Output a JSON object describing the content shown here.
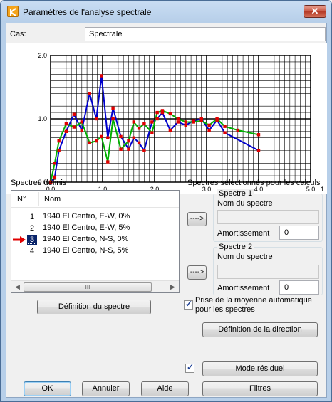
{
  "window": {
    "title": "Paramètres de l'analyse spectrale",
    "close_label": "✕"
  },
  "cas": {
    "label": "Cas:",
    "value": "Spectrale"
  },
  "chart_data": {
    "type": "line",
    "xlim": [
      0,
      5.0
    ],
    "ylim": [
      0,
      2.0
    ],
    "x_ticks": [
      "0.0",
      "1.0",
      "2.0",
      "3.0",
      "4.0",
      "5.0"
    ],
    "x_unit": "1",
    "y_ticks": [
      "0.0",
      "1.0",
      "2.0"
    ],
    "grid": true,
    "series": [
      {
        "color": "#0000cc",
        "points": [
          [
            0,
            0
          ],
          [
            0.08,
            0.08
          ],
          [
            0.16,
            0.5
          ],
          [
            0.3,
            0.8
          ],
          [
            0.45,
            1.07
          ],
          [
            0.6,
            0.82
          ],
          [
            0.75,
            1.4
          ],
          [
            0.88,
            1.0
          ],
          [
            0.98,
            1.68
          ],
          [
            1.1,
            0.7
          ],
          [
            1.2,
            1.17
          ],
          [
            1.35,
            0.72
          ],
          [
            1.5,
            0.52
          ],
          [
            1.6,
            0.7
          ],
          [
            1.7,
            0.62
          ],
          [
            1.8,
            0.5
          ],
          [
            1.95,
            0.95
          ],
          [
            2.05,
            1.0
          ],
          [
            2.15,
            1.1
          ],
          [
            2.3,
            0.82
          ],
          [
            2.45,
            0.95
          ],
          [
            2.6,
            0.9
          ],
          [
            2.75,
            0.97
          ],
          [
            2.9,
            1.0
          ],
          [
            3.05,
            0.82
          ],
          [
            3.2,
            0.98
          ],
          [
            3.35,
            0.78
          ],
          [
            4.0,
            0.5
          ]
        ]
      },
      {
        "color": "#00b000",
        "points": [
          [
            0,
            0
          ],
          [
            0.08,
            0.3
          ],
          [
            0.16,
            0.65
          ],
          [
            0.3,
            0.92
          ],
          [
            0.45,
            0.87
          ],
          [
            0.6,
            0.95
          ],
          [
            0.75,
            0.62
          ],
          [
            0.88,
            0.65
          ],
          [
            0.98,
            0.72
          ],
          [
            1.1,
            0.32
          ],
          [
            1.2,
            1.0
          ],
          [
            1.35,
            0.52
          ],
          [
            1.5,
            0.65
          ],
          [
            1.6,
            0.95
          ],
          [
            1.7,
            0.85
          ],
          [
            1.8,
            0.92
          ],
          [
            1.95,
            0.78
          ],
          [
            2.05,
            1.1
          ],
          [
            2.15,
            1.13
          ],
          [
            2.3,
            1.08
          ],
          [
            2.45,
            1.0
          ],
          [
            2.6,
            0.95
          ],
          [
            2.75,
            0.95
          ],
          [
            2.9,
            0.97
          ],
          [
            3.05,
            0.9
          ],
          [
            3.2,
            1.0
          ],
          [
            3.35,
            0.88
          ],
          [
            3.6,
            0.82
          ],
          [
            4.0,
            0.75
          ]
        ]
      }
    ]
  },
  "spectres": {
    "title": "Spectres définis",
    "col_n": "N°",
    "col_nom": "Nom",
    "rows": [
      {
        "n": "1",
        "nom": "1940 El Centro, E-W, 0%"
      },
      {
        "n": "2",
        "nom": "1940 El Centro, E-W, 5%"
      },
      {
        "n": "3",
        "nom": "1940 El Centro, N-S, 0%"
      },
      {
        "n": "4",
        "nom": "1940 El Centro, N-S, 5%"
      }
    ],
    "scroll_left": "◀",
    "scroll_right": "▶",
    "scroll_grip": "III",
    "definition_button": "Définition du spectre"
  },
  "selected": {
    "title": "Spectres sélectionnés pour les calculs",
    "spectre1": {
      "title": "Spectre 1",
      "name_label": "Nom du spectre",
      "name_value": "",
      "amort_label": "Amortissement",
      "amort_value": "0",
      "arrow_label": "---->"
    },
    "spectre2": {
      "title": "Spectre 2",
      "name_label": "Nom du spectre",
      "name_value": "",
      "amort_label": "Amortissement",
      "amort_value": "0",
      "arrow_label": "---->"
    },
    "moyenne_label_line1": "Prise de la moyenne automatique",
    "moyenne_label_line2": "pour les spectres",
    "moyenne_checked": "✓"
  },
  "direction_button": "Définition de la direction",
  "residuel": {
    "checked": "✓",
    "button": "Mode résiduel"
  },
  "footer": {
    "ok": "OK",
    "annuler": "Annuler",
    "aide": "Aide",
    "filtres": "Filtres"
  }
}
